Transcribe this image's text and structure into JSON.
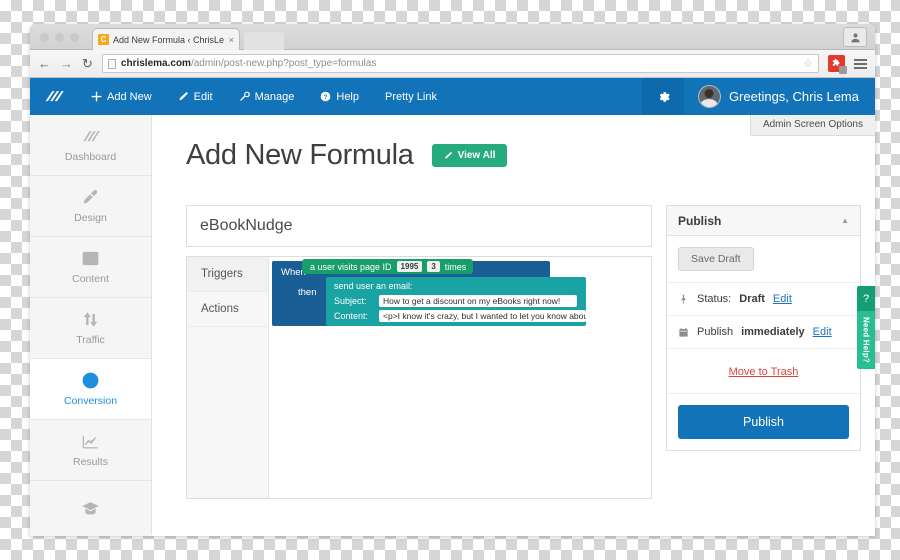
{
  "browser": {
    "tab_title": "Add New Formula ‹ ChrisLe",
    "tab_close": "×",
    "favicon_letter": "C",
    "back": "←",
    "forward": "→",
    "reload": "↻",
    "url_domain": "chrislema.com",
    "url_path": "/admin/post-new.php?post_type=formulas",
    "star_icon": "☆",
    "extension_icon": "puzzle-piece-icon",
    "menu_icon": "hamburger-menu-icon",
    "profile_icon": "user-profile-icon"
  },
  "adminbar": {
    "logo_icon": "slashes-logo-icon",
    "items": [
      {
        "label": "Add New",
        "icon": "plus-icon"
      },
      {
        "label": "Edit",
        "icon": "pencil-icon"
      },
      {
        "label": "Manage",
        "icon": "wrench-icon"
      },
      {
        "label": "Help",
        "icon": "question-circle-icon"
      },
      {
        "label": "Pretty Link",
        "icon": ""
      }
    ],
    "gear_icon": "gear-icon",
    "greeting": "Greetings, Chris Lema",
    "screen_options": "Admin Screen Options"
  },
  "sidebar": {
    "items": [
      {
        "label": "Dashboard",
        "icon": "dashboard-slashes-icon",
        "active": false
      },
      {
        "label": "Design",
        "icon": "paintbrush-icon",
        "active": false
      },
      {
        "label": "Content",
        "icon": "layout-grid-icon",
        "active": false
      },
      {
        "label": "Traffic",
        "icon": "up-down-arrows-icon",
        "active": false
      },
      {
        "label": "Conversion",
        "icon": "target-icon",
        "active": true
      },
      {
        "label": "Results",
        "icon": "line-chart-icon",
        "active": false
      },
      {
        "label": "",
        "icon": "graduation-cap-icon",
        "active": false
      }
    ]
  },
  "page": {
    "title": "Add New Formula",
    "view_all_label": "View All",
    "view_all_icon": "pencil-icon",
    "formula_title": "eBookNudge"
  },
  "editor": {
    "tabs": [
      {
        "label": "Triggers",
        "selected": true
      },
      {
        "label": "Actions",
        "selected": false
      }
    ],
    "formula": {
      "when_label": "When",
      "then_label": "then",
      "trigger_text_before": "a user visits page ID",
      "trigger_page_id": "1995",
      "trigger_count": "3",
      "trigger_text_after": "times",
      "action_title": "send user an email:",
      "subject_key": "Subject:",
      "subject_value": "How to get a discount on my eBooks right now!",
      "content_key": "Content:",
      "content_value": "<p>I know it's crazy, but I wanted to let you know abou"
    }
  },
  "publish": {
    "heading": "Publish",
    "collapse_icon": "▲",
    "save_draft_label": "Save Draft",
    "status_icon": "pin-icon",
    "status_prefix": "Status:",
    "status_value": "Draft",
    "status_edit": "Edit",
    "schedule_icon": "calendar-icon",
    "schedule_prefix": "Publish",
    "schedule_value": "immediately",
    "schedule_edit": "Edit",
    "trash_label": "Move to Trash",
    "publish_label": "Publish"
  },
  "help": {
    "question_mark": "?",
    "tab_label": "Need Help?"
  },
  "colors": {
    "admin_blue": "#1273b8",
    "accent_green": "#26ab7e",
    "trigger_green": "#179e6a",
    "action_teal": "#1aa3a3",
    "when_blue": "#1a5e96",
    "link_blue": "#1e73be",
    "trash_red": "#d9463f",
    "help_green": "#2bbd92"
  }
}
